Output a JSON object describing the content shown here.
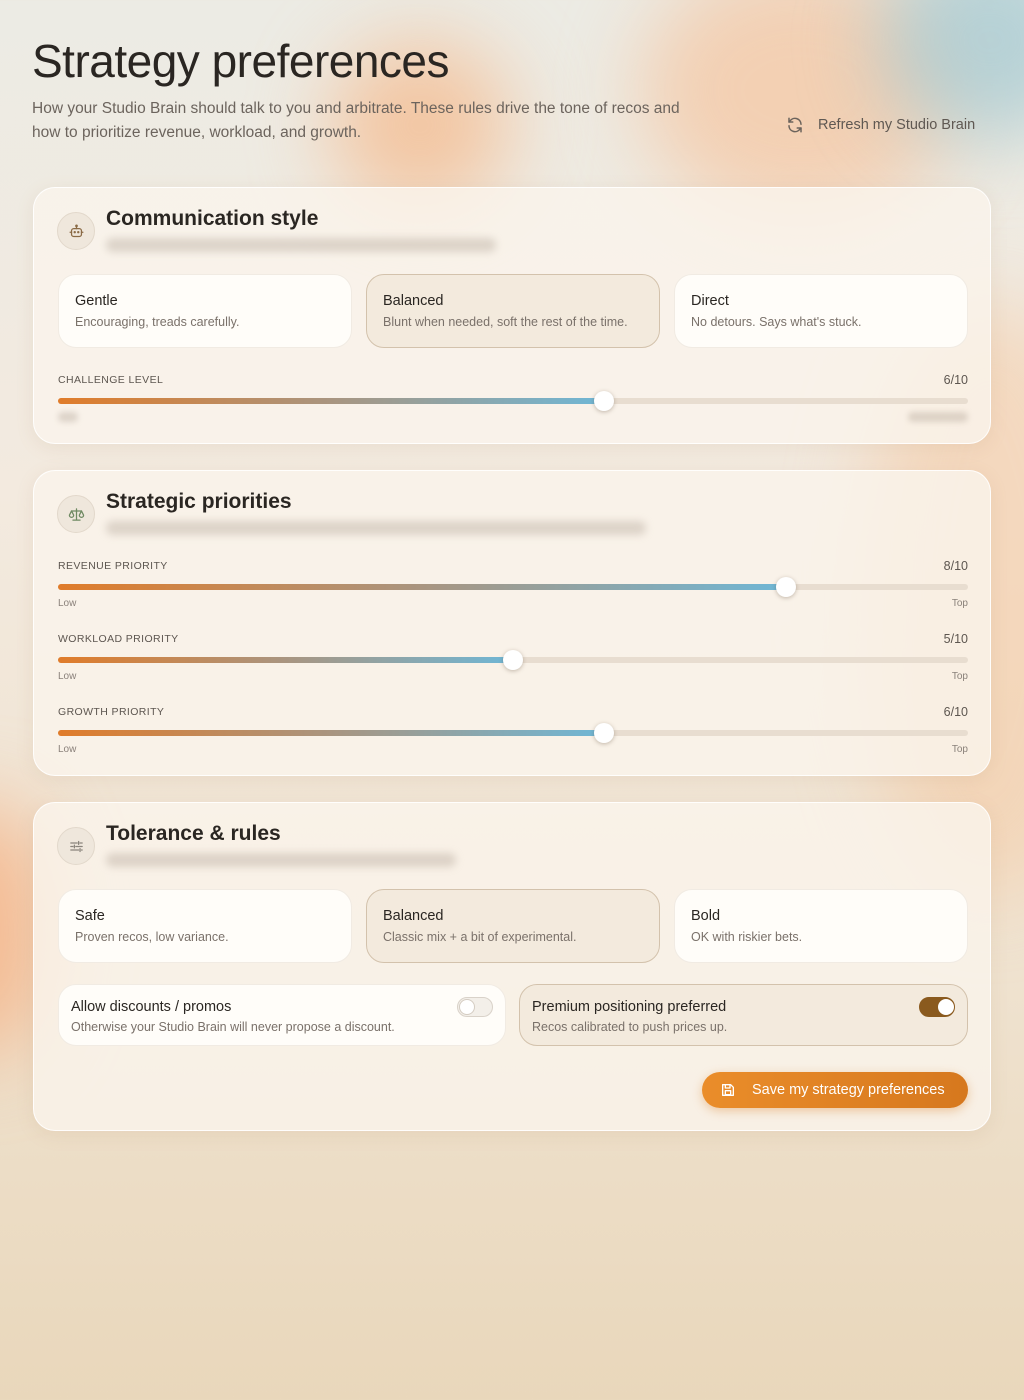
{
  "header": {
    "title": "Strategy preferences",
    "subtitle": "How your Studio Brain should talk to you and arbitrate. These rules drive the tone of recos and how to prioritize revenue, workload, and growth.",
    "refresh_label": "Refresh my Studio Brain"
  },
  "communication": {
    "title": "Communication style",
    "options": [
      {
        "label": "Gentle",
        "desc": "Encouraging, treads carefully."
      },
      {
        "label": "Balanced",
        "desc": "Blunt when needed, soft the rest of the time."
      },
      {
        "label": "Direct",
        "desc": "No detours. Says what's stuck."
      }
    ],
    "selected": "Balanced",
    "challenge": {
      "label": "CHALLENGE LEVEL",
      "value": 6,
      "max": 10,
      "display": "6/10"
    }
  },
  "priorities": {
    "title": "Strategic priorities",
    "sliders": [
      {
        "label": "REVENUE PRIORITY",
        "value": 8,
        "max": 10,
        "display": "8/10",
        "low": "Low",
        "high": "Top"
      },
      {
        "label": "WORKLOAD PRIORITY",
        "value": 5,
        "max": 10,
        "display": "5/10",
        "low": "Low",
        "high": "Top"
      },
      {
        "label": "GROWTH PRIORITY",
        "value": 6,
        "max": 10,
        "display": "6/10",
        "low": "Low",
        "high": "Top"
      }
    ]
  },
  "tolerance": {
    "title": "Tolerance & rules",
    "options": [
      {
        "label": "Safe",
        "desc": "Proven recos, low variance."
      },
      {
        "label": "Balanced",
        "desc": "Classic mix + a bit of experimental."
      },
      {
        "label": "Bold",
        "desc": "OK with riskier bets."
      }
    ],
    "selected": "Balanced",
    "toggles": [
      {
        "label": "Allow discounts / promos",
        "desc": "Otherwise your Studio Brain will never propose a discount.",
        "on": false
      },
      {
        "label": "Premium positioning preferred",
        "desc": "Recos calibrated to push prices up.",
        "on": true
      }
    ],
    "save_label": "Save my strategy preferences"
  },
  "colors": {
    "accent": "#e0862a",
    "toggle_on": "#8a5a1e",
    "slider_end": "#6fb7d6"
  }
}
